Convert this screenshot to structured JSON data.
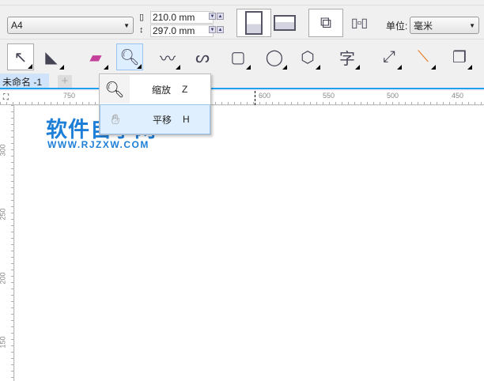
{
  "property_bar": {
    "page_size": "A4",
    "width": "210.0 mm",
    "height": "297.0 mm",
    "units_label": "单位:",
    "units_value": "毫米"
  },
  "document_tab": {
    "label": "未命名 -1",
    "add": "+"
  },
  "ruler": {
    "h_labels": [
      "750",
      "600",
      "550",
      "500",
      "450"
    ],
    "v_labels": [
      "300",
      "250",
      "200",
      "150"
    ]
  },
  "flyout": {
    "items": [
      {
        "label": "缩放",
        "shortcut": "Z"
      },
      {
        "label": "平移",
        "shortcut": "H"
      }
    ]
  },
  "watermark": {
    "title": "软件自学网",
    "url": "WWW.RJZXW.COM"
  }
}
